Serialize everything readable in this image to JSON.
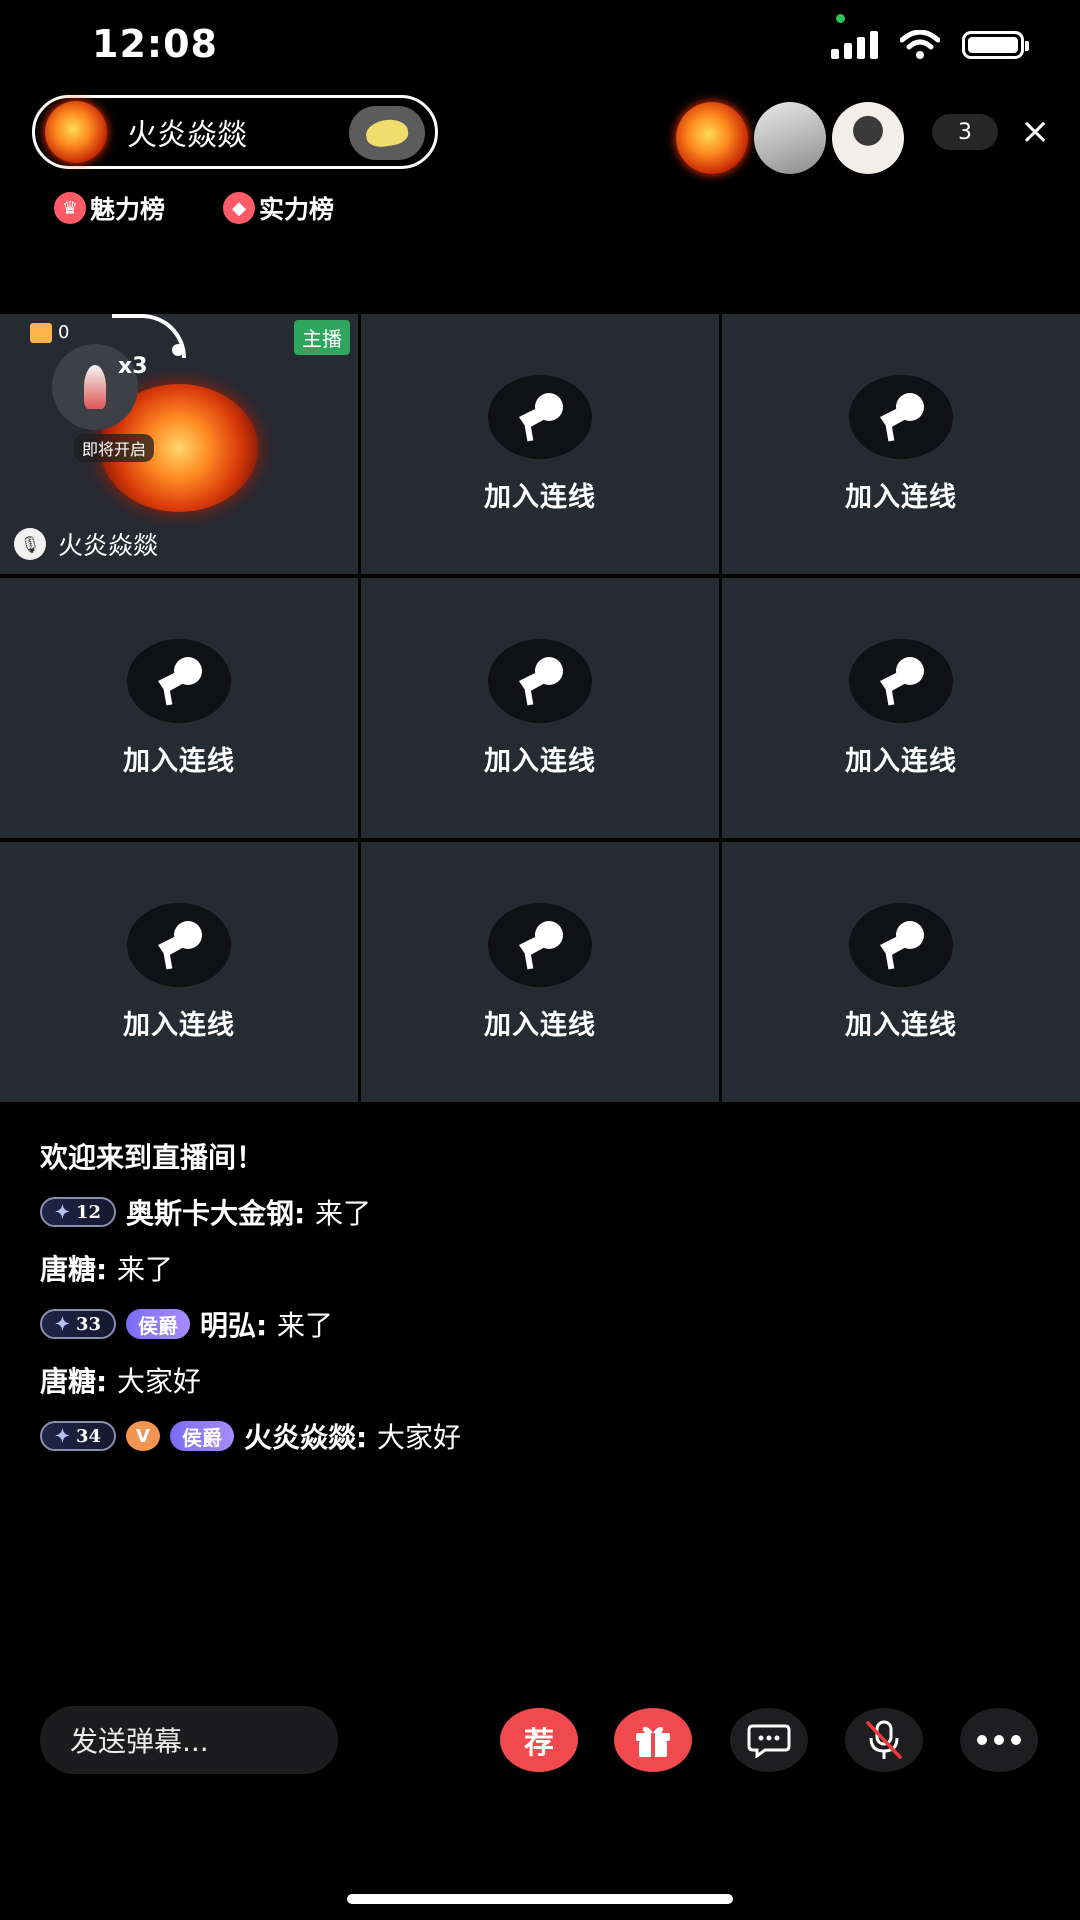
{
  "status": {
    "time": "12:08"
  },
  "header": {
    "host_name": "火炎焱燚",
    "rank_charm": "魅力榜",
    "rank_strength": "实力榜",
    "viewer_count": "3",
    "close_icon": "×"
  },
  "seats": {
    "host": {
      "badge": "主播",
      "gift_count": "0",
      "multiplier": "x3",
      "coming_soon": "即将开启",
      "name": "火炎焱燚"
    },
    "empty_label": "加入连线",
    "empty_labels": [
      "加入连线",
      "加入连线",
      "加入连线",
      "加入连线",
      "加入连线",
      "加入连线",
      "加入连线",
      "加入连线"
    ]
  },
  "chat": {
    "welcome": "欢迎来到直播间！",
    "messages": [
      {
        "level": "12",
        "title": "",
        "vip": "",
        "name": "奥斯卡大金钢",
        "text": "来了"
      },
      {
        "level": "",
        "title": "",
        "vip": "",
        "name": "唐糖",
        "text": "来了"
      },
      {
        "level": "33",
        "title": "侯爵",
        "vip": "",
        "name": "明弘",
        "text": "来了"
      },
      {
        "level": "",
        "title": "",
        "vip": "",
        "name": "唐糖",
        "text": "大家好"
      },
      {
        "level": "34",
        "title": "侯爵",
        "vip": "V",
        "name": "火炎焱燚",
        "text": "大家好"
      }
    ]
  },
  "bottom": {
    "danmaku_placeholder": "发送弹幕...",
    "recommend_label": "荐"
  }
}
